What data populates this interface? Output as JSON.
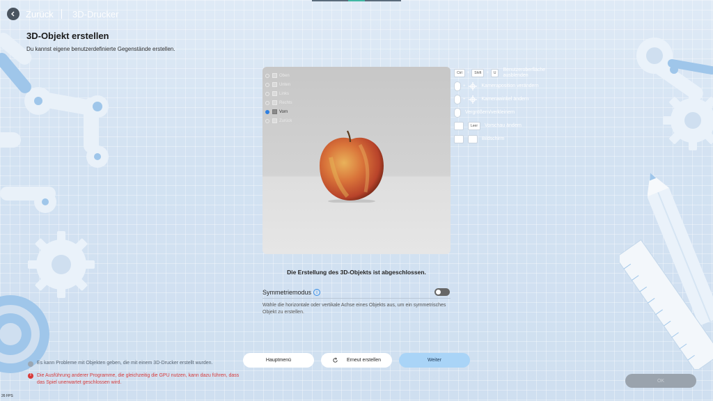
{
  "header": {
    "back_label": "Zurück",
    "breadcrumb": "3D-Drucker"
  },
  "page": {
    "title": "3D-Objekt erstellen",
    "subtitle": "Du kannst eigene benutzerdefinierte Gegenstände erstellen."
  },
  "preview": {
    "views": [
      {
        "label": "Oben",
        "selected": false
      },
      {
        "label": "Unten",
        "selected": false
      },
      {
        "label": "Links",
        "selected": false
      },
      {
        "label": "Rechts",
        "selected": false
      },
      {
        "label": "Vorn",
        "selected": true
      },
      {
        "label": "Zurück",
        "selected": false
      }
    ],
    "object_icon": "apple-model"
  },
  "shortcuts": {
    "ui_keys": [
      "Ctrl",
      "Shift",
      "U"
    ],
    "ui_label": "Benutzeroberfläche ausblenden",
    "camera_position_label": "Kameraposition verändern",
    "camera_angle_label": "Kamerawinkel ändern",
    "zoom_label": "Vergrößern/verkleinern",
    "zoom_key": "Leer",
    "window_label": "Vorschau ändern",
    "screenshot_label": "Bildschirm"
  },
  "status": {
    "message": "Die Erstellung des 3D-Objekts ist abgeschlossen."
  },
  "symmetry": {
    "label": "Symmetriemodus",
    "enabled": false,
    "description": "Wähle die horizontale oder vertikale Achse eines Objekts aus, um ein symmetrisches Objekt zu erstellen."
  },
  "buttons": {
    "main_menu": "Hauptmenü",
    "retry": "Erneut erstellen",
    "next": "Weiter",
    "ok": "OK"
  },
  "notes": {
    "info": "Es kann Probleme mit Objekten geben, die mit einem 3D-Drucker erstellt wurden.",
    "warning": "Die Ausführung anderer Programme, die gleichzeitig die GPU nutzen, kann dazu führen, dass das Spiel unerwartet geschlossen wird."
  },
  "fps": "26 FPS",
  "colors": {
    "accent": "#2f7fe0",
    "next_button": "#a9d4f7",
    "warning": "#d73a3a",
    "deco_blue": "#9fc6ea"
  }
}
